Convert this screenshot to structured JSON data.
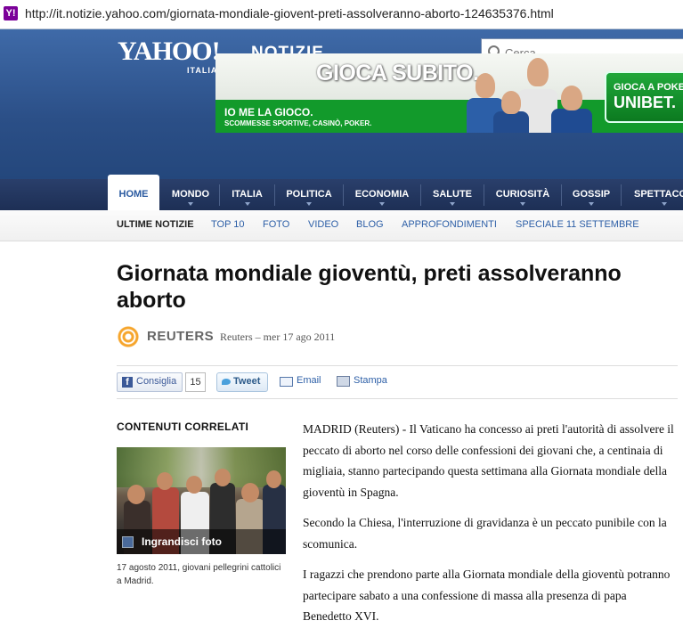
{
  "browser": {
    "url": "http://it.notizie.yahoo.com/giornata-mondiale-giovent-preti-assolveranno-aborto-124635376.html",
    "favicon": "Y!"
  },
  "header": {
    "logo": "YAHOO!",
    "logo_sub": "ITALIA",
    "section": "NOTIZIE",
    "search_placeholder": "Cerca"
  },
  "banner": {
    "headline": "GIOCA SUBITO.",
    "tagline": "IO ME LA GIOCO.",
    "subline": "SCOMMESSE SPORTIVE, CASINÒ, POKER.",
    "cta_line1": "GIOCA A POKE",
    "cta_line2": "UNIBET."
  },
  "nav": {
    "items": [
      "HOME",
      "MONDO",
      "ITALIA",
      "POLITICA",
      "ECONOMIA",
      "SALUTE",
      "CURIOSITÀ",
      "GOSSIP",
      "SPETTACO"
    ]
  },
  "subnav": {
    "items": [
      "ULTIME NOTIZIE",
      "TOP 10",
      "FOTO",
      "VIDEO",
      "BLOG",
      "APPROFONDIMENTI",
      "SPECIALE 11 SETTEMBRE"
    ]
  },
  "article": {
    "title": "Giornata mondiale gioventù, preti assolveranno aborto",
    "source_logo": "REUTERS",
    "byline": "Reuters – mer 17 ago 2011",
    "paragraphs": [
      "MADRID (Reuters) - Il Vaticano ha concesso ai preti l'autorità di assolvere il peccato di aborto nel corso delle confessioni dei giovani che, a centinaia di migliaia, stanno partecipando questa settimana alla Giornata mondiale della gioventù in Spagna.",
      "Secondo la Chiesa, l'interruzione di gravidanza è un peccato punibile con la scomunica.",
      "I ragazzi che prendono parte alla Giornata mondiale della gioventù potranno partecipare sabato a una confessione di massa alla presenza di papa Benedetto XVI."
    ]
  },
  "share": {
    "facebook_label": "Consiglia",
    "facebook_count": "15",
    "tweet_label": "Tweet",
    "email_label": "Email",
    "print_label": "Stampa"
  },
  "related": {
    "heading": "CONTENUTI CORRELATI",
    "enlarge_label": "Ingrandisci foto",
    "caption": "17 agosto 2011, giovani pellegrini cattolici a Madrid."
  }
}
